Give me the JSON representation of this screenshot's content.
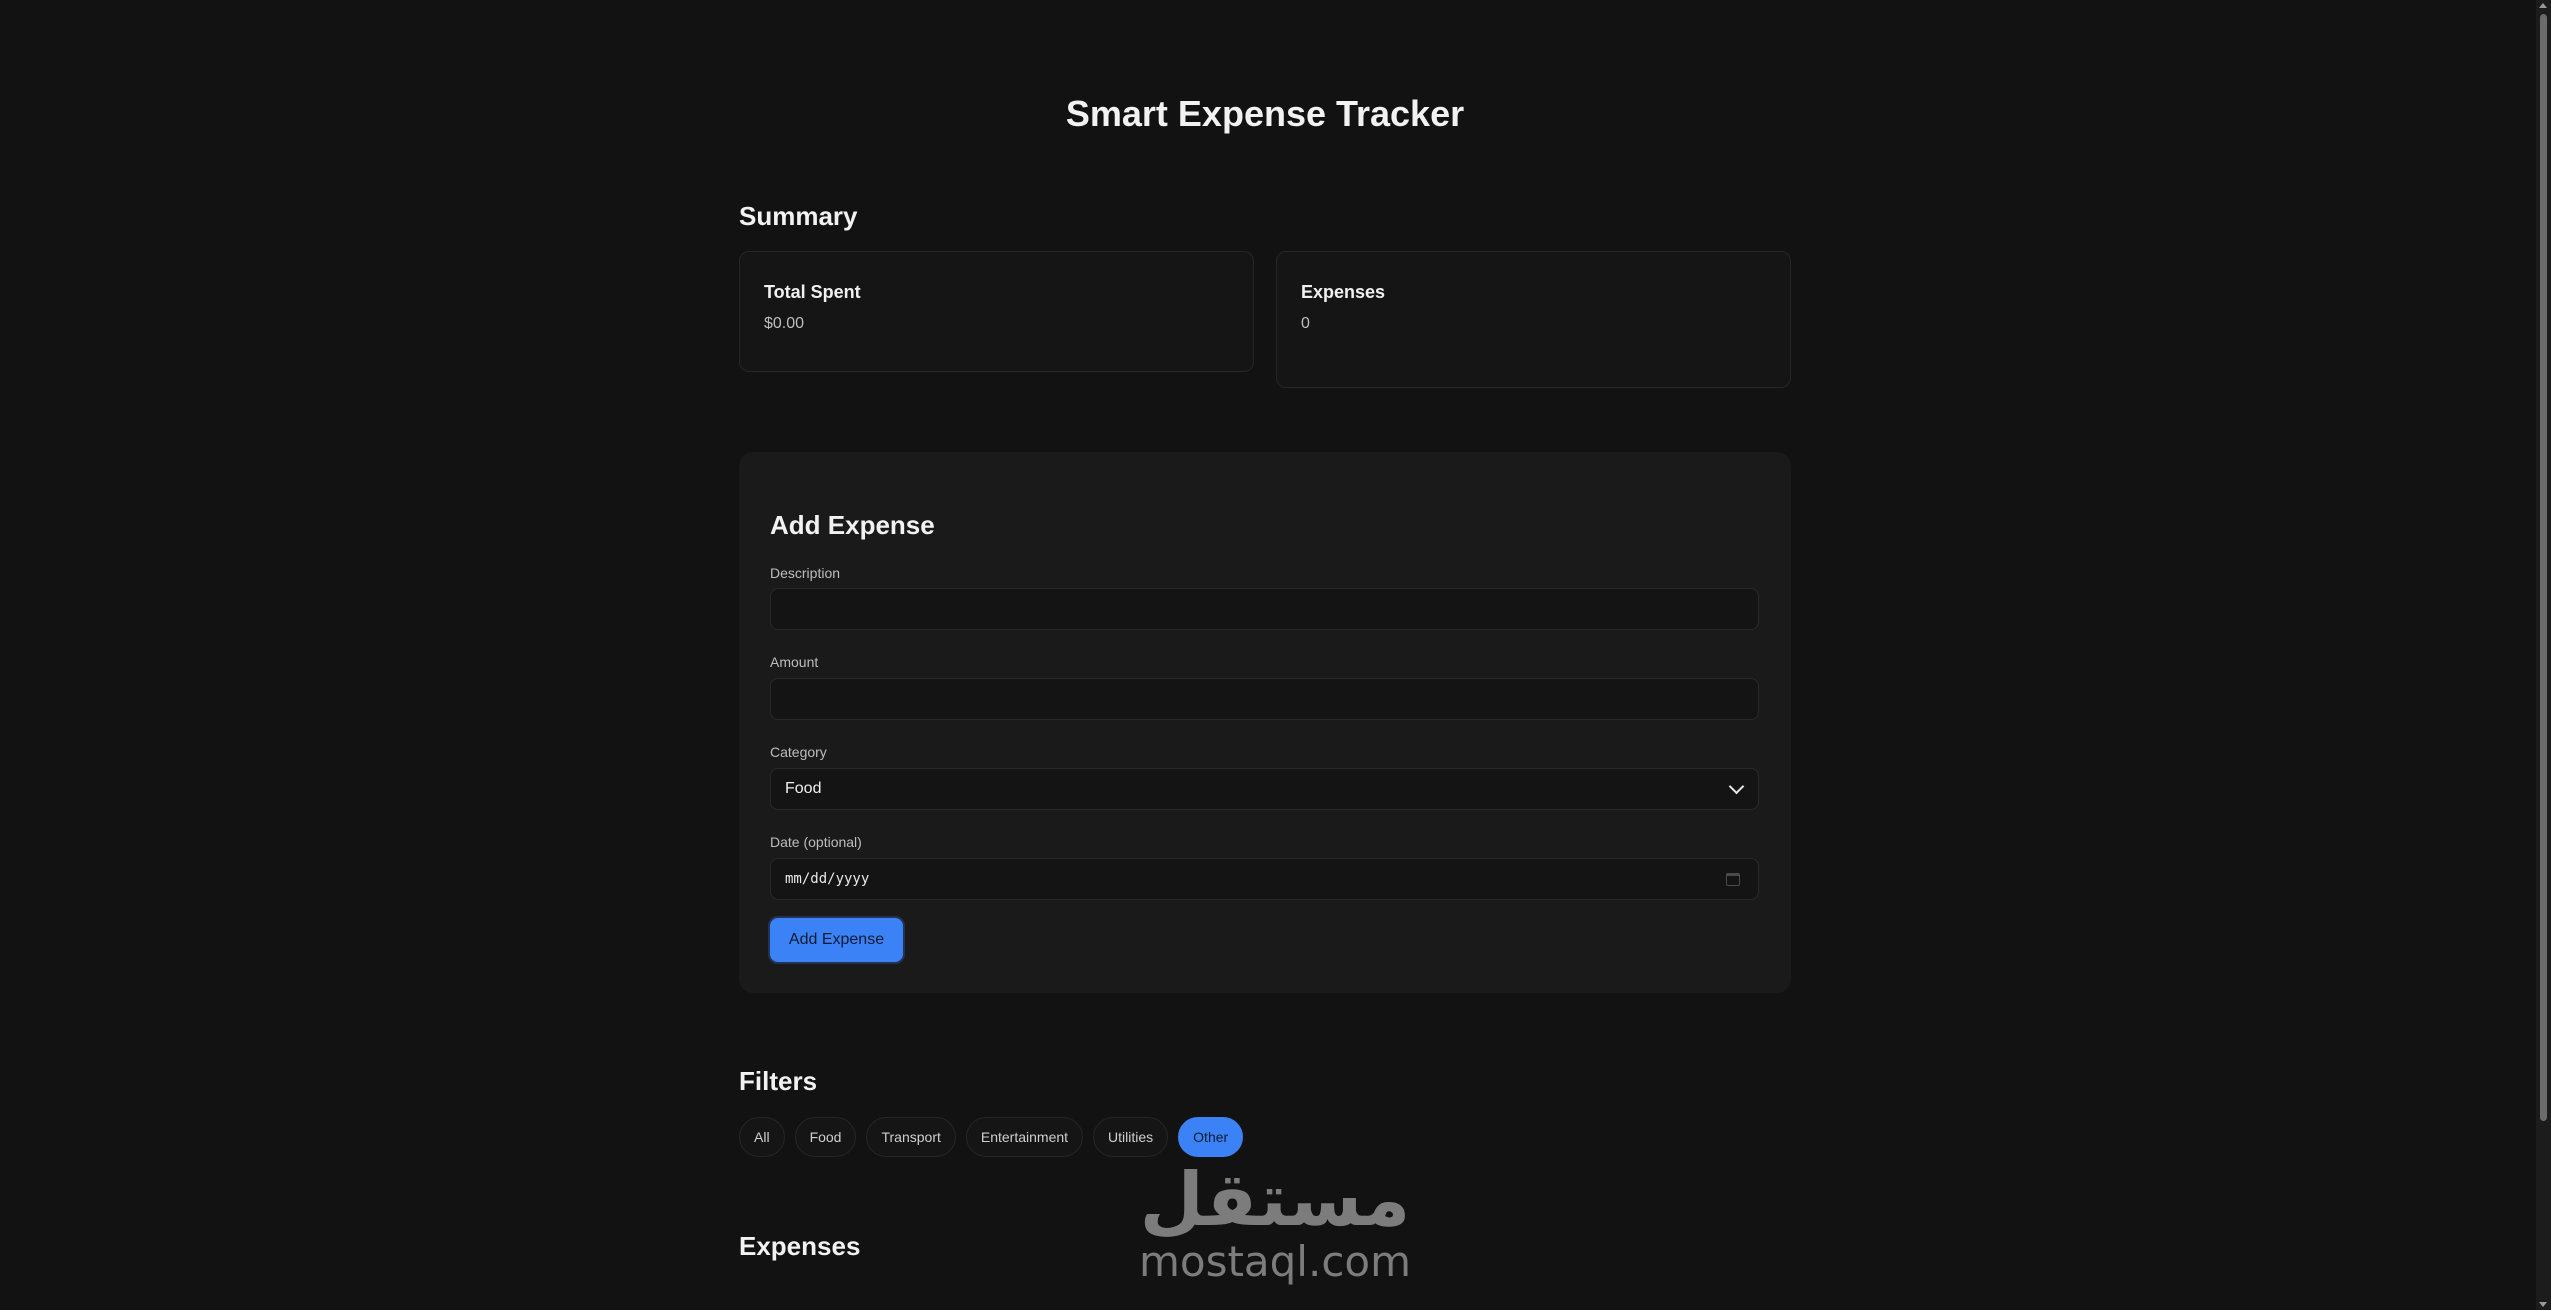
{
  "app": {
    "title": "Smart Expense Tracker"
  },
  "summary": {
    "heading": "Summary",
    "total_spent": {
      "label": "Total Spent",
      "value": "$0.00"
    },
    "expenses": {
      "label": "Expenses",
      "value": "0"
    }
  },
  "form": {
    "heading": "Add Expense",
    "description": {
      "label": "Description",
      "value": "",
      "placeholder": ""
    },
    "amount": {
      "label": "Amount",
      "value": "",
      "placeholder": ""
    },
    "category": {
      "label": "Category",
      "selected": "Food"
    },
    "date": {
      "label": "Date (optional)",
      "placeholder": "mm/dd/yyyy"
    },
    "submit_label": "Add Expense"
  },
  "filters": {
    "heading": "Filters",
    "chips": [
      "All",
      "Food",
      "Transport",
      "Entertainment",
      "Utilities",
      "Other"
    ],
    "active": "Other"
  },
  "expenses_section": {
    "heading": "Expenses"
  },
  "watermark": {
    "arabic": "مستقل",
    "latin": "mostaql.com"
  },
  "colors": {
    "background": "#121212",
    "panel": "#1a1a1a",
    "accent": "#3b82f6"
  }
}
